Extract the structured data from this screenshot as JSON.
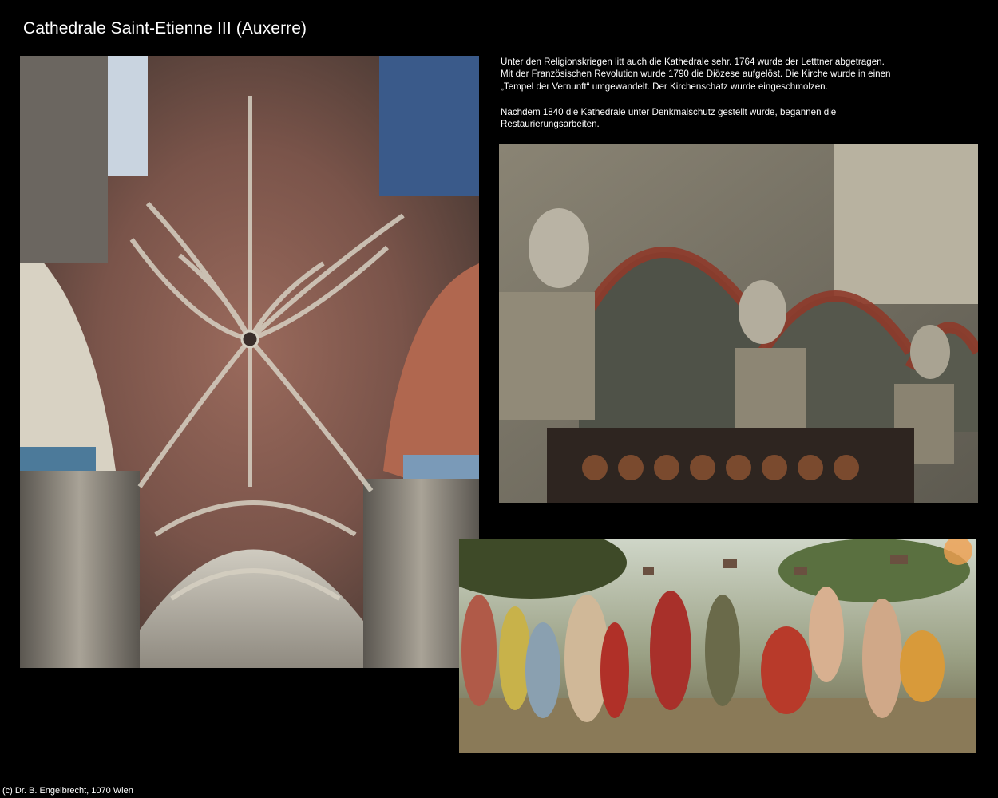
{
  "page": {
    "title": "Cathedrale Saint-Etienne III (Auxerre)",
    "paragraph1": [
      "Unter den Religionskriegen litt auch die Kathedrale sehr. 1764 wurde der Letttner abgetragen.",
      "Mit der Französischen Revolution wurde 1790 die Diözese aufgelöst. Die Kirche wurde in einen",
      "„Tempel der Vernunft“ umgewandelt. Der Kirchenschatz wurde eingeschmolzen."
    ],
    "paragraph2": [
      "Nachdem 1840 die Kathedrale unter Denkmalschutz gestellt wurde, begannen die",
      "Restaurierungsarbeiten."
    ],
    "footer": "(c) Dr. B. Engelbrecht, 1070 Wien"
  },
  "colors": {
    "background": "#000000",
    "text": "#ffffff"
  }
}
